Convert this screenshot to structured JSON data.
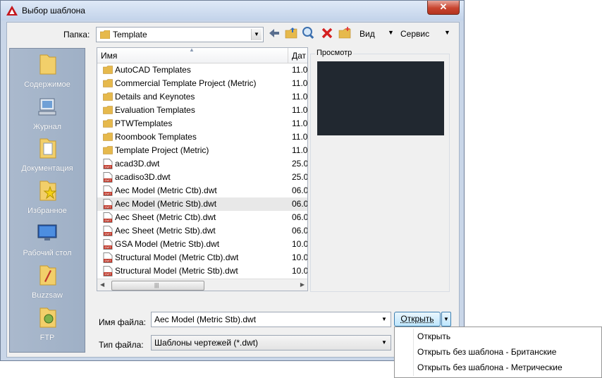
{
  "window": {
    "title": "Выбор шаблона",
    "close_glyph": "✕"
  },
  "folder": {
    "label": "Папка:",
    "value": "Template"
  },
  "toolbar": {
    "view_label": "Вид",
    "tools_label": "Сервис",
    "icons": [
      "back-icon",
      "up-folder-icon",
      "search-web-icon",
      "delete-icon",
      "new-folder-icon"
    ]
  },
  "places": [
    {
      "label": "Содержимое",
      "icon": "folder-icon"
    },
    {
      "label": "Журнал",
      "icon": "history-icon"
    },
    {
      "label": "Документация",
      "icon": "documents-icon"
    },
    {
      "label": "Избранное",
      "icon": "favorites-icon"
    },
    {
      "label": "Рабочий стол",
      "icon": "desktop-icon"
    },
    {
      "label": "Buzzsaw",
      "icon": "buzzsaw-icon"
    },
    {
      "label": "FTP",
      "icon": "ftp-icon"
    }
  ],
  "filelist": {
    "col_name": "Имя",
    "col_date": "Дат",
    "rows": [
      {
        "name": "AutoCAD Templates",
        "date": "11.0",
        "type": "folder"
      },
      {
        "name": "Commercial Template Project (Metric)",
        "date": "11.0",
        "type": "folder"
      },
      {
        "name": "Details and Keynotes",
        "date": "11.0",
        "type": "folder"
      },
      {
        "name": "Evaluation Templates",
        "date": "11.0",
        "type": "folder"
      },
      {
        "name": "PTWTemplates",
        "date": "11.0",
        "type": "folder"
      },
      {
        "name": "Roombook Templates",
        "date": "11.0",
        "type": "folder"
      },
      {
        "name": "Template Project (Metric)",
        "date": "11.0",
        "type": "folder"
      },
      {
        "name": "acad3D.dwt",
        "date": "25.0",
        "type": "dwt"
      },
      {
        "name": "acadiso3D.dwt",
        "date": "25.0",
        "type": "dwt"
      },
      {
        "name": "Aec Model (Metric Ctb).dwt",
        "date": "06.0",
        "type": "dwt"
      },
      {
        "name": "Aec Model (Metric Stb).dwt",
        "date": "06.0",
        "type": "dwt",
        "selected": true
      },
      {
        "name": "Aec Sheet (Metric Ctb).dwt",
        "date": "06.0",
        "type": "dwt"
      },
      {
        "name": "Aec Sheet (Metric Stb).dwt",
        "date": "06.0",
        "type": "dwt"
      },
      {
        "name": "GSA Model (Metric Stb).dwt",
        "date": "10.0",
        "type": "dwt"
      },
      {
        "name": "Structural Model (Metric Ctb).dwt",
        "date": "10.0",
        "type": "dwt"
      },
      {
        "name": "Structural Model (Metric Stb).dwt",
        "date": "10.0",
        "type": "dwt"
      }
    ]
  },
  "preview": {
    "label": "Просмотр",
    "bg_color": "#212830"
  },
  "filename": {
    "label": "Имя файла:",
    "value": "Aec Model (Metric Stb).dwt"
  },
  "filetype": {
    "label": "Тип файла:",
    "value": "Шаблоны чертежей (*.dwt)"
  },
  "open_button": {
    "label": "Открыть"
  },
  "open_menu": [
    "Открыть",
    "Открыть без шаблона - Британские",
    "Открыть без шаблона - Метрические"
  ]
}
